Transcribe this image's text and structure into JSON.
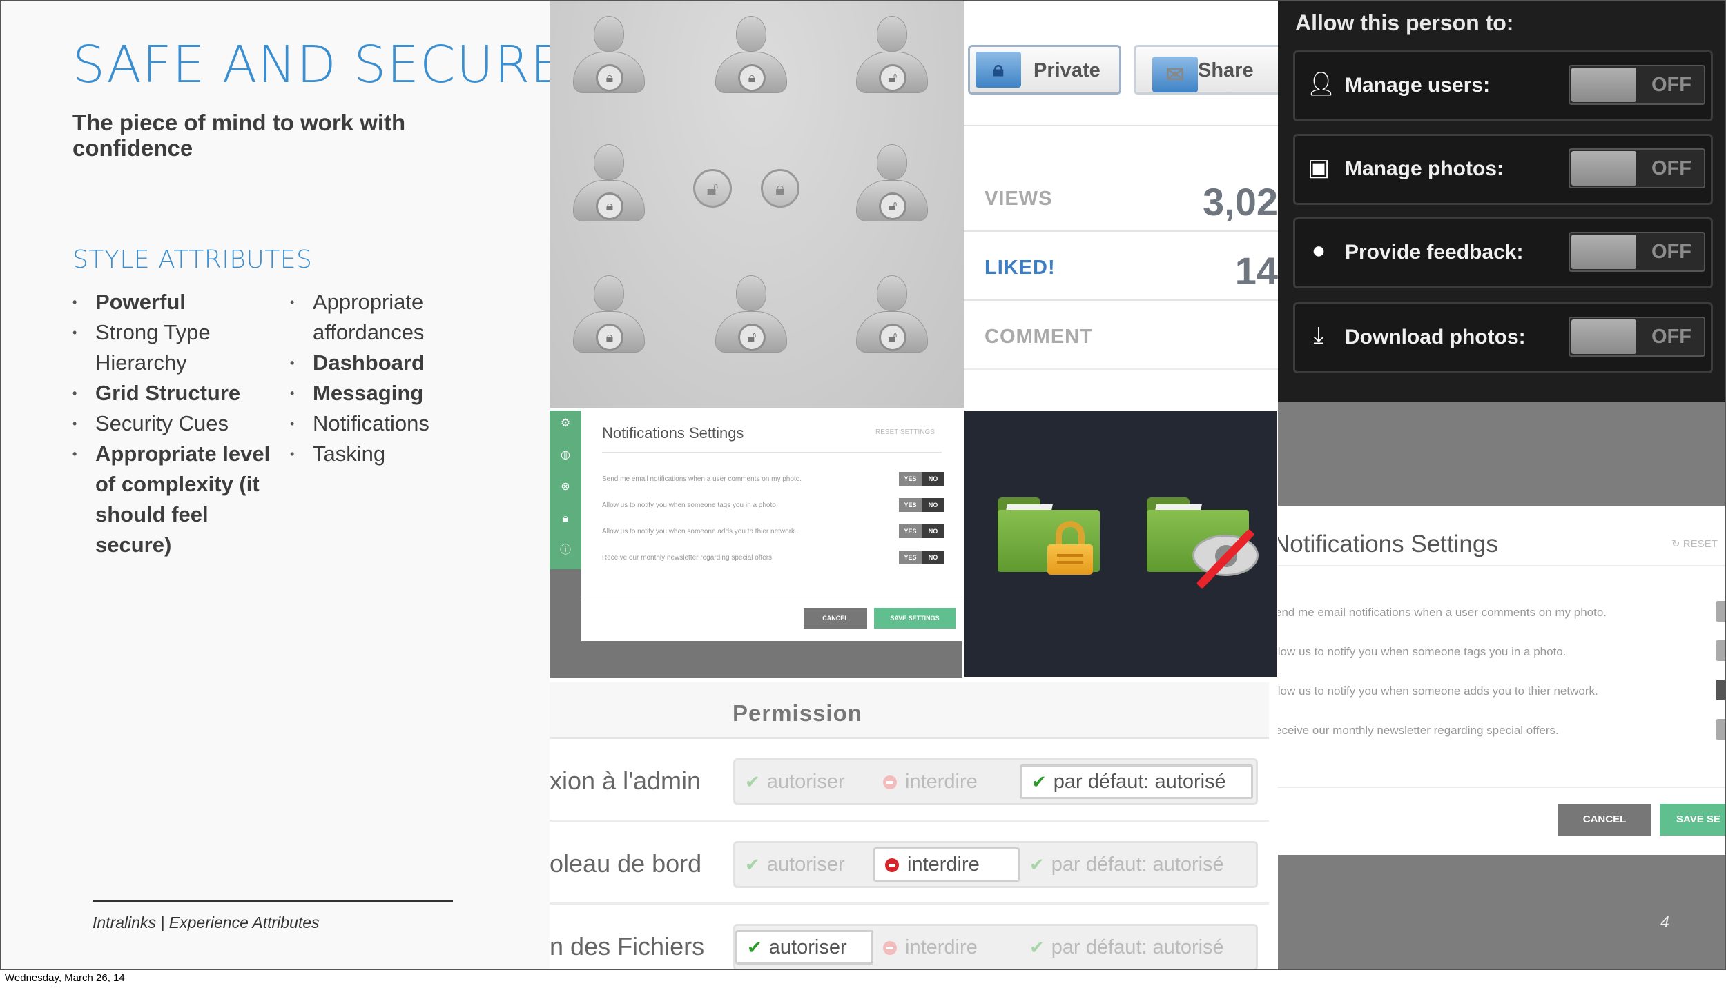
{
  "slide": {
    "title": "SAFE AND SECURE",
    "subtitle": "The piece of mind to work with confidence",
    "attributes_heading": "STYLE ATTRIBUTES",
    "attributes_col1": [
      {
        "text": "Powerful",
        "bold": true
      },
      {
        "text": "Strong Type Hierarchy",
        "bold": false
      },
      {
        "text": "Grid Structure",
        "bold": true
      },
      {
        "text": "Security Cues",
        "bold": false
      },
      {
        "text": "Appropriate level of complexity (it should feel secure)",
        "bold": true
      }
    ],
    "attributes_col2": [
      {
        "text": "Appropriate affordances",
        "bold": false
      },
      {
        "text": "Dashboard",
        "bold": true
      },
      {
        "text": "Messaging",
        "bold": true
      },
      {
        "text": "Notifications",
        "bold": false
      },
      {
        "text": "Tasking",
        "bold": false
      }
    ],
    "footer": "Intralinks | Experience Attributes",
    "page_number": "4",
    "date": "Wednesday, March 26, 14"
  },
  "stats_panel": {
    "private_label": "Private",
    "share_label": "Share",
    "rows": [
      {
        "label": "VIEWS",
        "value": "3,02",
        "label_color": "#aaaaaa",
        "icon": ">"
      },
      {
        "label": "LIKED!",
        "value": "14",
        "label_color": "#3b7ec6",
        "icon": "heart-icon"
      },
      {
        "label": "COMMENT",
        "value": "",
        "label_color": "#aaaaaa",
        "icon": "comment-icon"
      }
    ]
  },
  "permissions_dark": {
    "title": "Allow this person to:",
    "rows": [
      {
        "label": "Manage users:",
        "icon": "user-icon",
        "state": "OFF"
      },
      {
        "label": "Manage photos:",
        "icon": "photos-icon",
        "state": "OFF"
      },
      {
        "label": "Provide feedback:",
        "icon": "speech-bubble-icon",
        "state": "OFF"
      },
      {
        "label": "Download photos:",
        "icon": "download-icon",
        "state": "OFF"
      }
    ]
  },
  "notifications_small": {
    "title": "Notifications Settings",
    "reset": "RESET SETTINGS",
    "rows": [
      "Send me email notifications when a user comments on my photo.",
      "Allow us to notify you when someone tags you in a photo.",
      "Allow us to notify you when someone adds you to thier network.",
      "Receive our monthly newsletter regarding special offers."
    ],
    "yes": "YES",
    "no": "NO",
    "cancel": "CANCEL",
    "save": "SAVE SETTINGS"
  },
  "permission_table": {
    "title": "Permission",
    "rows": [
      {
        "label": "xion à l'admin",
        "selected": 2
      },
      {
        "label": "oleau de bord",
        "selected": 1
      },
      {
        "label": "n des Fichiers",
        "selected": 0
      }
    ],
    "options": [
      "autoriser",
      "interdire",
      "par défaut: autorisé"
    ]
  },
  "notifications_large": {
    "title": "Notifications Settings",
    "reset": "RESET",
    "rows": [
      "end me email notifications when a user comments on my photo.",
      "llow us to notify you when someone tags you in a photo.",
      "llow us to notify you when someone adds you to thier network.",
      "eceive our monthly newsletter regarding special offers."
    ],
    "cancel": "CANCEL",
    "save": "SAVE SE"
  },
  "colors": {
    "accent_blue": "#3b8fd1",
    "green": "#5fbf8e",
    "dark_bg": "#1e1e1e",
    "folder_green": "#6fab3c",
    "lock_gold": "#f0b030",
    "slash_red": "#e8232a"
  }
}
